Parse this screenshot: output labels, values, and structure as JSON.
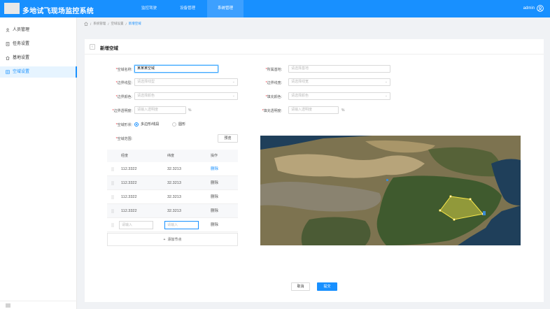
{
  "app": {
    "title": "多地试飞现场监控系统",
    "user": "admin"
  },
  "nav": [
    {
      "label": "监控驾驶",
      "active": false
    },
    {
      "label": "设备管理",
      "active": false
    },
    {
      "label": "系统管理",
      "active": true
    }
  ],
  "sidebar": {
    "items": [
      {
        "label": "人员管理",
        "icon": "person-icon"
      },
      {
        "label": "任务设置",
        "icon": "document-icon"
      },
      {
        "label": "基地设置",
        "icon": "home-icon"
      },
      {
        "label": "空域设置",
        "icon": "grid-icon",
        "active": true
      }
    ]
  },
  "breadcrumb": [
    "系统管理",
    "空域设置",
    "新增空域"
  ],
  "page": {
    "title": "新增空域"
  },
  "form": {
    "name_label": "空域名称:",
    "name_value": "某某某空域",
    "base_label": "所属基地:",
    "base_placeholder": "请选择基地",
    "border_type_label": "边界线型:",
    "border_type_placeholder": "请选择线型",
    "border_width_label": "边界线宽:",
    "border_width_placeholder": "请选择线宽",
    "border_color_label": "边界颜色:",
    "border_color_placeholder": "请选择颜色",
    "fill_color_label": "填充颜色:",
    "fill_color_placeholder": "请选择颜色",
    "border_opacity_label": "边界透明度:",
    "border_opacity_placeholder": "请输入透明度",
    "fill_opacity_label": "填充透明度:",
    "fill_opacity_placeholder": "请输入透明度",
    "percent": "%",
    "shape_label": "空域形状:",
    "shape_options": [
      "多边形/线段",
      "圆形"
    ],
    "range_label": "空域范围:",
    "preview_label": "预览"
  },
  "table": {
    "columns": [
      "经度",
      "纬度",
      "操作"
    ],
    "rows": [
      {
        "lng": "112.3322",
        "lat": "32.3213",
        "op": "删除"
      },
      {
        "lng": "112.3322",
        "lat": "32.3213",
        "op": "删除"
      },
      {
        "lng": "112.3322",
        "lat": "32.3213",
        "op": "删除"
      },
      {
        "lng": "112.3322",
        "lat": "32.3213",
        "op": "删除"
      }
    ],
    "input_row": {
      "lng_placeholder": "请输入",
      "lat_placeholder": "请输入",
      "op": "删除"
    },
    "add_label": "添加节点"
  },
  "actions": {
    "cancel": "取消",
    "submit": "提交"
  },
  "colors": {
    "primary": "#1890ff",
    "polygon": "#f7e64a"
  }
}
